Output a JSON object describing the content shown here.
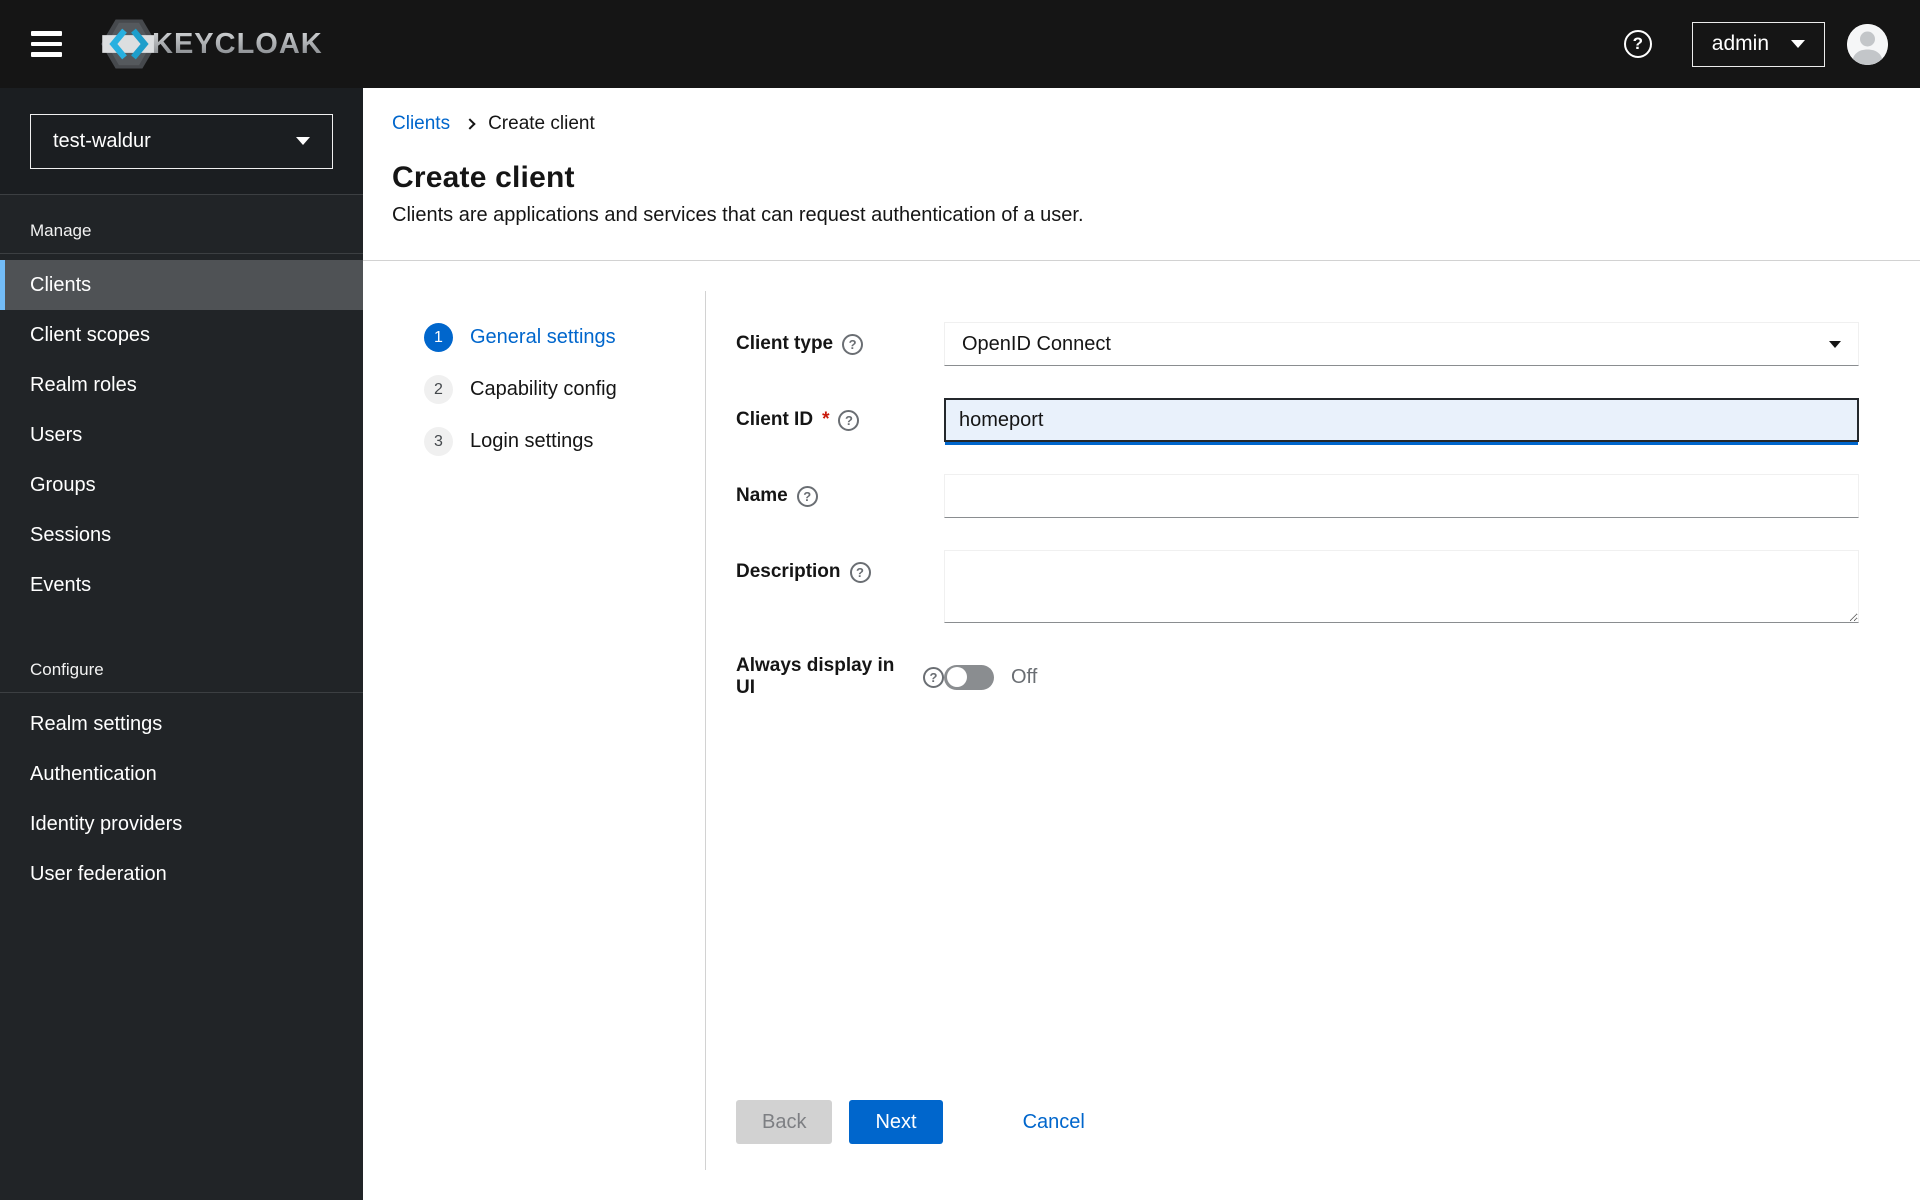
{
  "header": {
    "brand": "KEYCLOAK",
    "user_menu": "admin"
  },
  "sidebar": {
    "realm": "test-waldur",
    "active_item": "Clients",
    "sections": [
      {
        "label": "Manage",
        "items": [
          "Clients",
          "Client scopes",
          "Realm roles",
          "Users",
          "Groups",
          "Sessions",
          "Events"
        ]
      },
      {
        "label": "Configure",
        "items": [
          "Realm settings",
          "Authentication",
          "Identity providers",
          "User federation"
        ]
      }
    ]
  },
  "breadcrumb": {
    "parent": "Clients",
    "current": "Create client"
  },
  "page": {
    "title": "Create client",
    "subtitle": "Clients are applications and services that can request authentication of a user."
  },
  "wizard": {
    "active_step": "General settings",
    "steps": [
      {
        "number": "1",
        "label": "General settings"
      },
      {
        "number": "2",
        "label": "Capability config"
      },
      {
        "number": "3",
        "label": "Login settings"
      }
    ]
  },
  "form": {
    "client_type": {
      "label": "Client type",
      "value": "OpenID Connect"
    },
    "client_id": {
      "label": "Client ID",
      "required_marker": "*",
      "value": "homeport"
    },
    "name": {
      "label": "Name",
      "value": ""
    },
    "description": {
      "label": "Description",
      "value": ""
    },
    "always_display": {
      "label": "Always display in UI",
      "state": "Off"
    }
  },
  "actions": {
    "back": "Back",
    "next": "Next",
    "cancel": "Cancel"
  },
  "colors": {
    "accent": "#0066cc",
    "masthead_bg": "#151515",
    "sidebar_bg": "#212427",
    "nav_active_bg": "#4f5255",
    "nav_active_accent": "#73bcf7",
    "focused_input_bg": "#e9f1fb",
    "toggle_off": "#8a8d90",
    "disabled_bg": "#d2d2d2",
    "required_marker": "#c9190b",
    "logo_cyan": "#29b3e4"
  }
}
